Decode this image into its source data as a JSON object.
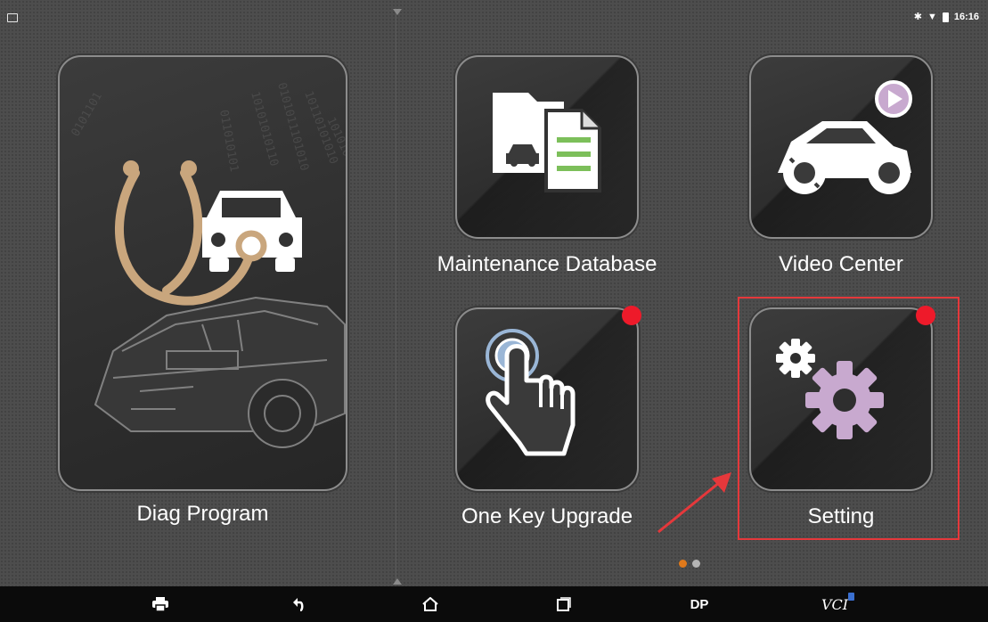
{
  "status_bar": {
    "time": "16:16",
    "left_icon": "image-notification-icon",
    "right_icons": [
      "bluetooth-icon",
      "wifi-icon",
      "battery-icon"
    ]
  },
  "tiles": [
    {
      "id": "diag",
      "label": "Diag Program",
      "icon": "stethoscope-car-icon",
      "badge": false
    },
    {
      "id": "maintenance",
      "label": "Maintenance Database",
      "icon": "folder-document-icon",
      "badge": false
    },
    {
      "id": "video",
      "label": "Video Center",
      "icon": "car-play-icon",
      "badge": false
    },
    {
      "id": "upgrade",
      "label": "One Key Upgrade",
      "icon": "touch-hand-icon",
      "badge": true
    },
    {
      "id": "setting",
      "label": "Setting",
      "icon": "gears-icon",
      "badge": true
    }
  ],
  "annotation": {
    "highlighted_tile": "Setting",
    "arrow": "red-arrow"
  },
  "pager": {
    "pages": 2,
    "active": 1
  },
  "nav_bar": {
    "items": [
      {
        "icon": "print-icon"
      },
      {
        "icon": "back-icon"
      },
      {
        "icon": "home-icon"
      },
      {
        "icon": "recent-apps-icon"
      },
      {
        "label": "DP"
      },
      {
        "label": "VCI"
      }
    ]
  },
  "colors": {
    "badge": "#ee1a2a",
    "highlight": "#e5383b",
    "pager_active": "#e0791b",
    "pager_inactive": "#b5b5b5",
    "gear": "#c8a9cf",
    "stethoscope": "#c9a67d"
  }
}
